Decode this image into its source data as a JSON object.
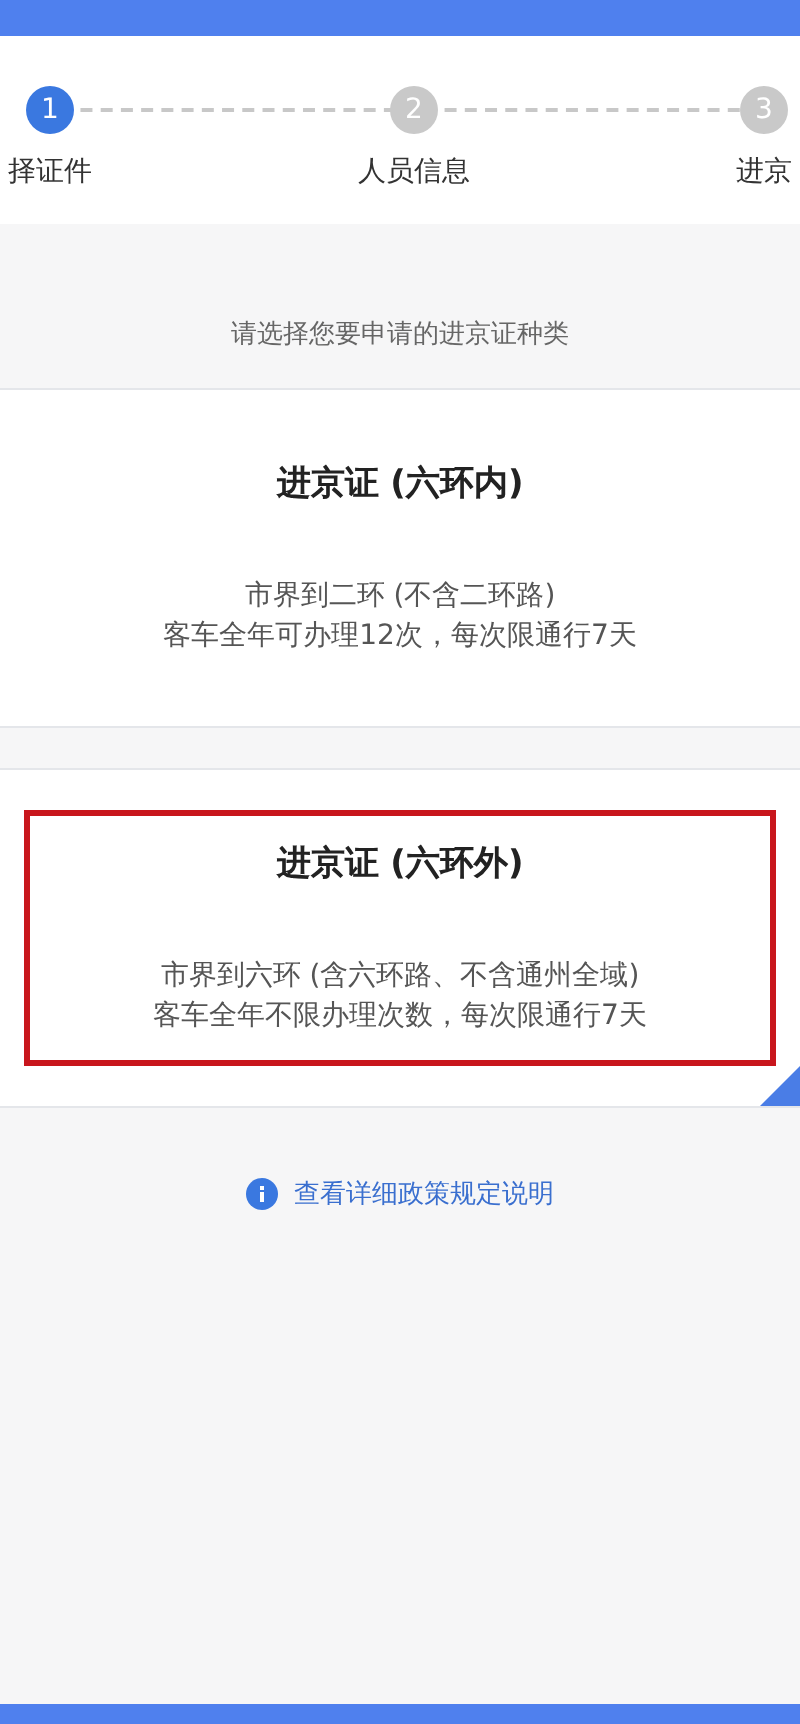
{
  "steps": [
    {
      "number": "1",
      "label": "择证件",
      "selected": true
    },
    {
      "number": "2",
      "label": "人员信息",
      "selected": false
    },
    {
      "number": "3",
      "label": "进京",
      "selected": false
    }
  ],
  "prompt": "请选择您要申请的进京证种类",
  "cards": [
    {
      "title": "进京证 (六环内)",
      "lines": [
        "市界到二环 (不含二环路)",
        "客车全年可办理12次，每次限通行7天"
      ],
      "selected": false,
      "highlighted": false
    },
    {
      "title": "进京证 (六环外)",
      "lines": [
        "市界到六环 (含六环路、不含通州全域)",
        "客车全年不限办理次数，每次限通行7天"
      ],
      "selected": true,
      "highlighted": true
    }
  ],
  "policy_link": "查看详细政策规定说明"
}
